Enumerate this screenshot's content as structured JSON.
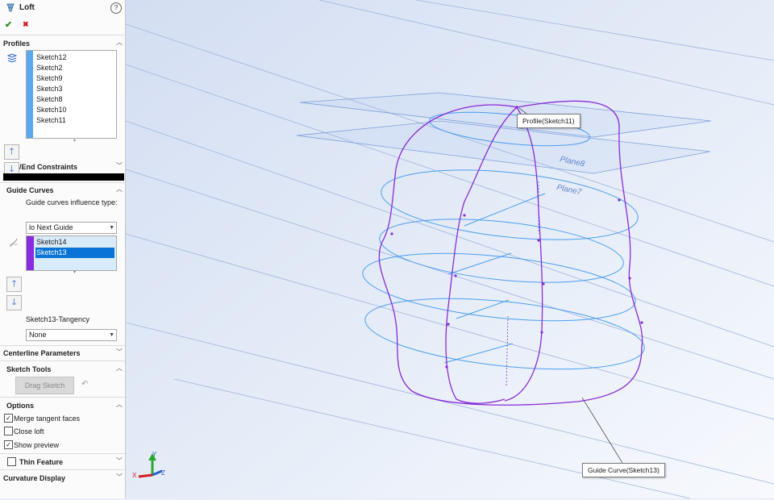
{
  "header": {
    "title": "Loft",
    "help_symbol": "?",
    "ok_symbol": "✔",
    "cancel_symbol": "✖"
  },
  "profiles": {
    "title": "Profiles",
    "items": [
      "Sketch12",
      "Sketch2",
      "Sketch9",
      "Sketch3",
      "Sketch8",
      "Sketch10",
      "Sketch11"
    ]
  },
  "end_constraints": {
    "title": "/End Constraints"
  },
  "guide_curves": {
    "title": "Guide Curves",
    "influence_label": "Guide curves influence type:",
    "influence_value": "lo Next Guide",
    "items": [
      "Sketch14",
      "Sketch13"
    ],
    "selected_index": 1,
    "tangency_label": "Sketch13-Tangency",
    "tangency_value": "None"
  },
  "centerline": {
    "title": "Centerline Parameters"
  },
  "sketch_tools": {
    "title": "Sketch Tools",
    "drag_label": "Drag Sketch"
  },
  "options": {
    "title": "Options",
    "merge_label": "Merge tangent faces",
    "merge_checked": true,
    "close_label": "Close loft",
    "close_checked": false,
    "preview_label": "Show preview",
    "preview_checked": true
  },
  "thin_feature": {
    "title": "Thin Feature",
    "checked": false
  },
  "curvature": {
    "title": "Curvature Display"
  },
  "viewport": {
    "plane_labels": [
      "Plane8",
      "Plane7"
    ],
    "callout_profile": "Profile(Sketch11)",
    "callout_guide": "Guide Curve(Sketch13)",
    "triad": {
      "x": "X",
      "y": "Y",
      "z": "Z"
    }
  },
  "colors": {
    "profile_bar": "#5aa8f0",
    "guide_bar": "#8a2be2",
    "selection": "#0a74d6",
    "sketch_blue": "#4a9ef0",
    "loft_purple": "#8a2bd6"
  }
}
